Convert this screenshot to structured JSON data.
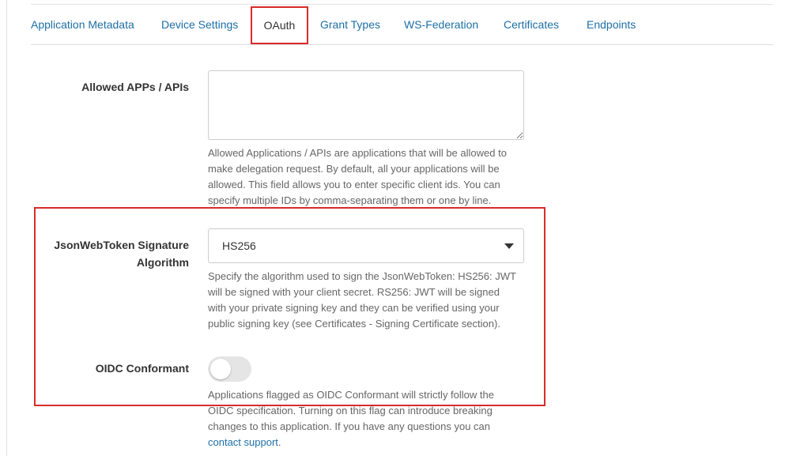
{
  "tabs": [
    {
      "label": "Application Metadata"
    },
    {
      "label": "Device Settings"
    },
    {
      "label": "OAuth",
      "active": true
    },
    {
      "label": "Grant Types"
    },
    {
      "label": "WS-Federation"
    },
    {
      "label": "Certificates"
    },
    {
      "label": "Endpoints"
    }
  ],
  "allowed_apps": {
    "label": "Allowed APPs / APIs",
    "value": "",
    "help": [
      "Allowed Applications / APIs are applications that will be allowed to",
      "make delegation request. By default, all your applications will be",
      "allowed. This field allows you to enter specific client ids. You can",
      "specify multiple IDs by comma-separating them or one by line."
    ]
  },
  "jwt_algorithm": {
    "label_line1": "JsonWebToken Signature",
    "label_line2": "Algorithm",
    "selected": "HS256",
    "help": [
      "Specify the algorithm used to sign the JsonWebToken: HS256: JWT",
      "will be signed with your client secret. RS256: JWT will be signed",
      "with your private signing key and they can be verified using your",
      "public signing key (see Certificates - Signing Certificate section)."
    ]
  },
  "oidc": {
    "label": "OIDC Conformant",
    "enabled": false,
    "help": [
      "Applications flagged as OIDC Conformant will strictly follow the",
      "OIDC specification. Turning on this flag can introduce breaking",
      "changes to this application. If you have any questions you can"
    ],
    "link_text": "contact support",
    "link_suffix": "."
  },
  "colors": {
    "link": "#1d6fa5",
    "highlight": "#d92b2b",
    "toggle_off": "#e5e5e5"
  }
}
